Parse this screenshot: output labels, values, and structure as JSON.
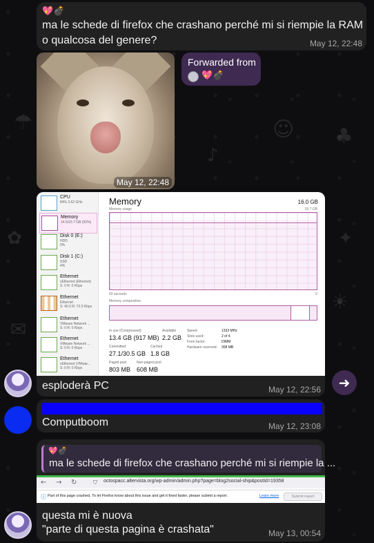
{
  "colors": {
    "bubble": "#212121",
    "accent": "#3f2a52",
    "redaction": "#0a00ff"
  },
  "messages": {
    "m1": {
      "sender_emoji": "💖💣",
      "text_line1": "ma le schede di firefox che crashano perché mi si riempie la RAM",
      "text_line2": "o qualcosa del genere?",
      "time": "May 12, 22:48"
    },
    "photo": {
      "time": "May 12, 22:48"
    },
    "forward": {
      "label": "Forwarded from",
      "sender_emoji": "💖💣"
    },
    "m3": {
      "text": "esploderà PC",
      "time": "May 12, 22:56",
      "share_icon": "arrow-right-icon"
    },
    "m4": {
      "text": "Computboom",
      "time": "May 12, 23:08"
    },
    "m5": {
      "reply_emoji": "💖💣",
      "reply_text": "ma le schede di firefox che crashano perché mi si riempie la ...",
      "text_line1": "questa mi è nuova",
      "text_line2": "\"parte di questa pagina è crashata\"",
      "time": "May 13, 00:54"
    }
  },
  "taskmanager": {
    "title": "Memory",
    "total": "16.0 GB",
    "usage_caption": "Memory usage",
    "usage_max": "15.7 GB",
    "axis_left": "60 seconds",
    "axis_right": "0",
    "composition_caption": "Memory composition",
    "sidebar": [
      {
        "name": "CPU",
        "sub": "84% 3.62 GHz",
        "kind": "cpu"
      },
      {
        "name": "Memory",
        "sub": "14.5/15.7 GB (92%)",
        "kind": "mem",
        "selected": true
      },
      {
        "name": "Disk 0 (E:)",
        "sub": "HDD\n0%",
        "kind": "disk"
      },
      {
        "name": "Disk 1 (C:)",
        "sub": "SSD\n4%",
        "kind": "disk"
      },
      {
        "name": "Ethernet",
        "sub": "vEthernet (Ethernet)\nS: 0 R: 0 Kbps",
        "kind": "disk"
      },
      {
        "name": "Ethernet",
        "sub": "Ethernet\nS: 40.0 R: 72.0 Kbps",
        "kind": "eth"
      },
      {
        "name": "Ethernet",
        "sub": "VMware Network ...\nS: 0 R: 0 Kbps",
        "kind": "disk"
      },
      {
        "name": "Ethernet",
        "sub": "VMware Network ...\nS: 0 R: 0 Kbps",
        "kind": "disk"
      },
      {
        "name": "Ethernet",
        "sub": "vEthernet (VMwar...\nS: 0 R: 0 Kbps",
        "kind": "disk"
      }
    ],
    "stats": {
      "in_use_label": "In use (Compressed)",
      "in_use": "13.4 GB (917 MB)",
      "available_label": "Available",
      "available": "2.2 GB",
      "committed_label": "Committed",
      "committed": "27.1/30.5 GB",
      "cached_label": "Cached",
      "cached": "1.8 GB",
      "paged_label": "Paged pool",
      "paged": "803 MB",
      "nonpaged_label": "Non-paged pool",
      "nonpaged": "608 MB"
    },
    "specs": [
      {
        "k": "Speed:",
        "v": "1333 MHz"
      },
      {
        "k": "Slots used:",
        "v": "2 of 4"
      },
      {
        "k": "Form factor:",
        "v": "DIMM"
      },
      {
        "k": "Hardware reserved:",
        "v": "308 MB"
      }
    ]
  },
  "firefox": {
    "url": "octospacc.altervista.org/wp-admin/admin.php?page=blog2social-ship&postId=19358",
    "crash_text": "Part of this page crashed. To let Firefox know about this issue and get it fixed faster, please submit a report.",
    "learn_more": "Learn more",
    "submit": "Submit report"
  }
}
